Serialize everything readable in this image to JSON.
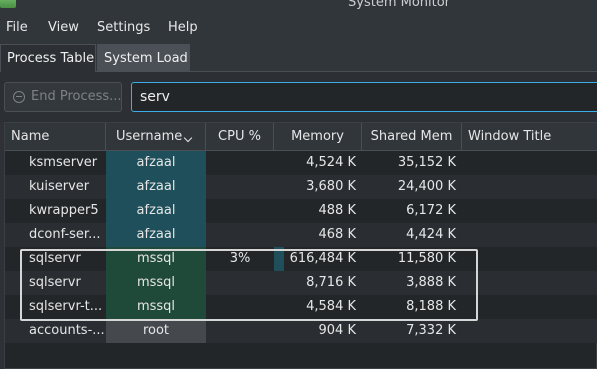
{
  "window": {
    "title": "System Monitor"
  },
  "menu": [
    "File",
    "View",
    "Settings",
    "Help"
  ],
  "tabs": [
    {
      "label": "Process Table",
      "active": true
    },
    {
      "label": "System Load",
      "active": false
    }
  ],
  "toolbar": {
    "end_process_label": "End Process...",
    "search_value": "serv"
  },
  "table": {
    "columns": [
      "Name",
      "Username",
      "CPU %",
      "Memory",
      "Shared Mem",
      "Window Title"
    ],
    "sorted_column": "Username",
    "rows": [
      {
        "name": "ksmserver",
        "username": "afzaal",
        "cpu": "",
        "memory": "4,524 K",
        "shared": "35,152 K",
        "window_title": ""
      },
      {
        "name": "kuiserver",
        "username": "afzaal",
        "cpu": "",
        "memory": "3,680 K",
        "shared": "24,400 K",
        "window_title": ""
      },
      {
        "name": "kwrapper5",
        "username": "afzaal",
        "cpu": "",
        "memory": "488 K",
        "shared": "6,172 K",
        "window_title": ""
      },
      {
        "name": "dconf-ser...",
        "username": "afzaal",
        "cpu": "",
        "memory": "468 K",
        "shared": "4,424 K",
        "window_title": ""
      },
      {
        "name": "sqlservr",
        "username": "mssql",
        "cpu": "3%",
        "memory": "616,484 K",
        "shared": "11,580 K",
        "window_title": ""
      },
      {
        "name": "sqlservr",
        "username": "mssql",
        "cpu": "",
        "memory": "8,716 K",
        "shared": "3,888 K",
        "window_title": ""
      },
      {
        "name": "sqlservr-t...",
        "username": "mssql",
        "cpu": "",
        "memory": "4,584 K",
        "shared": "8,188 K",
        "window_title": ""
      },
      {
        "name": "accounts-...",
        "username": "root",
        "cpu": "",
        "memory": "904 K",
        "shared": "7,332 K",
        "window_title": ""
      }
    ]
  },
  "colors": {
    "accent": "#3daee9",
    "afzaal_bg": "#1e4f5a",
    "mssql_bg": "#1f4a3a",
    "root_bg": "#45494e"
  },
  "icons": {
    "app": "system-monitor-icon",
    "end_process": "stop-circle-icon",
    "sort": "chevron-down-icon"
  }
}
